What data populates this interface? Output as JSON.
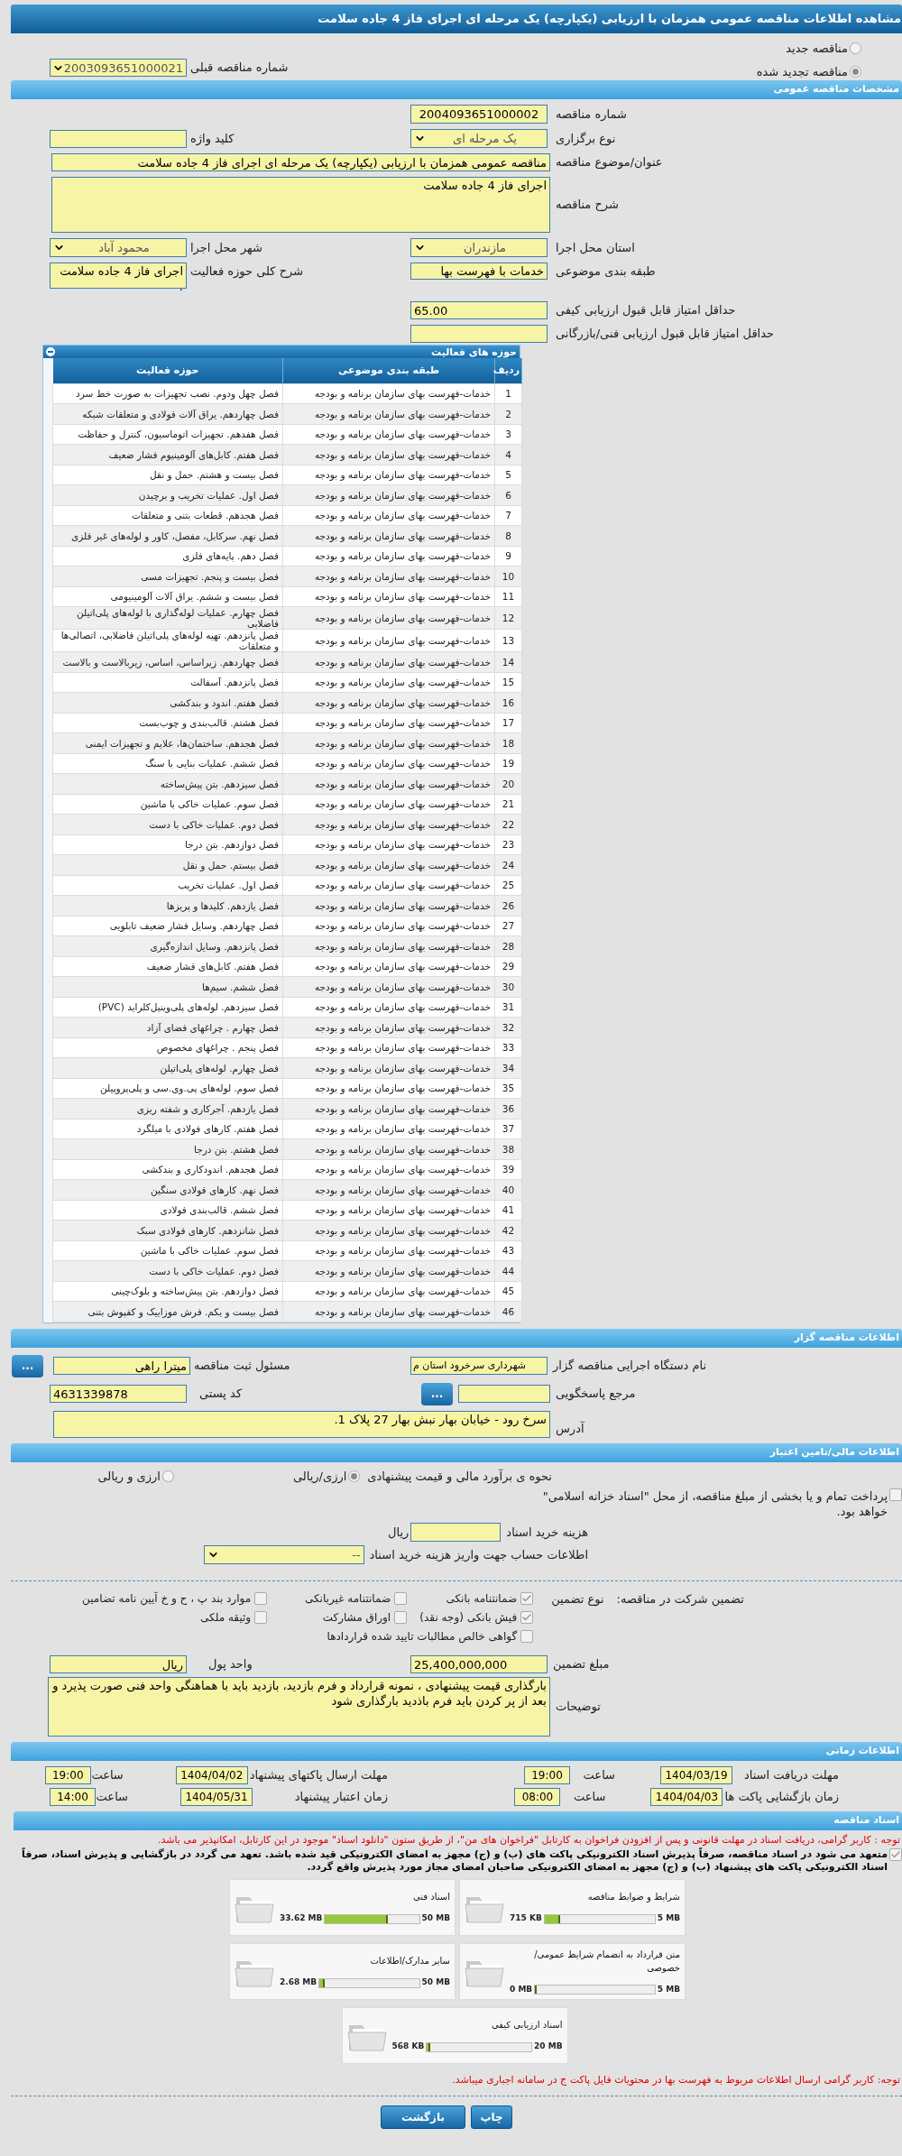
{
  "window": {
    "title": "مشاهده اطلاعات مناقصه عمومی همزمان با ارزیابی (یکپارچه) یک مرحله ای اجرای فاز 4 جاده سلامت"
  },
  "tender_status": [
    {
      "label": "مناقصه جدید",
      "selected": false
    },
    {
      "label": "مناقصه تجدید شده",
      "selected": true
    }
  ],
  "previous_tender": {
    "label": "شماره مناقصه قبلی",
    "value": "2003093651000021"
  },
  "general": {
    "title": "مشخصات مناقصه عمومی",
    "tender_number": {
      "label": "شماره مناقصه",
      "value": "2004093651000002"
    },
    "keyword": {
      "label": "کلید واژه"
    },
    "holding_type": {
      "label": "نوع برگزاری",
      "value": "یک مرحله ای"
    },
    "subject": {
      "label": "عنوان/موضوع مناقصه",
      "value": "مناقصه عمومی همزمان با ارزیابی (یکپارچه) یک مرحله ای اجرای فاز 4 جاده سلامت"
    },
    "description": {
      "label": "شرح مناقصه",
      "value": "اجرای فاز 4 جاده سلامت"
    },
    "city": {
      "label": "شهر محل اجرا",
      "value": "محمود آباد"
    },
    "province": {
      "label": "استان محل اجرا",
      "value": "مازندران"
    },
    "activity_scope": {
      "label": "شرح کلی حوزه فعالیت",
      "value": "اجرای فاز 4 جاده سلامت ."
    },
    "category": {
      "label": "طبقه بندی موضوعی",
      "value": "خدمات با فهرست بها"
    },
    "min_quality_score": {
      "label": "حداقل امتیاز قابل قبول ارزیابی کیفی",
      "value": "65.00"
    },
    "min_technical_score": {
      "label": "حداقل امتیاز قابل قبول ارزیابی فنی/بازرگانی"
    }
  },
  "activities": {
    "title": "حوزه های فعالیت",
    "columns": [
      "ردیف",
      "طبقه بندی موضوعی",
      "حوزه فعالیت"
    ],
    "rows": [
      [
        "1",
        "خدمات-فهرست بهای سازمان برنامه و بودجه",
        "فصل چهل ودوم. نصب تجهیزات به صورت خط سرد"
      ],
      [
        "2",
        "خدمات-فهرست بهای سازمان برنامه و بودجه",
        "فصل چهاردهم. یراق آلات فولادی و متعلقات شبکه"
      ],
      [
        "3",
        "خدمات-فهرست بهای سازمان برنامه و بودجه",
        "فصل هفدهم. تجهیزات اتوماسیون، کنترل و حفاظت"
      ],
      [
        "4",
        "خدمات-فهرست بهای سازمان برنامه و بودجه",
        "فصل هفتم. کابل‌های آلومینیوم فشار ضعیف"
      ],
      [
        "5",
        "خدمات-فهرست بهای سازمان برنامه و بودجه",
        "فصل بیست و هشتم. حمل و نقل"
      ],
      [
        "6",
        "خدمات-فهرست بهای سازمان برنامه و بودجه",
        "فصل اول. عملیات تخریب و برچیدن"
      ],
      [
        "7",
        "خدمات-فهرست بهای سازمان برنامه و بودجه",
        "فصل هجدهم. قطعات بتنی و متعلقات"
      ],
      [
        "8",
        "خدمات-فهرست بهای سازمان برنامه و بودجه",
        "فصل نهم. سرکابل، مفصل، کاور و لوله‌های غیر فلزی"
      ],
      [
        "9",
        "خدمات-فهرست بهای سازمان برنامه و بودجه",
        "فصل دهم. پایه‌های فلزی"
      ],
      [
        "10",
        "خدمات-فهرست بهای سازمان برنامه و بودجه",
        "فصل بیست و پنجم. تجهیزات مسی"
      ],
      [
        "11",
        "خدمات-فهرست بهای سازمان برنامه و بودجه",
        "فصل بیست و ششم. یراق آلات آلومینیومی"
      ],
      [
        "12",
        "خدمات-فهرست بهای سازمان برنامه و بودجه",
        "فصل چهارم. عملیات لوله‌گذاری با لوله‌های پلی‌اتیلن فاضلابی"
      ],
      [
        "13",
        "خدمات-فهرست بهای سازمان برنامه و بودجه",
        "فصل پانزدهم. تهیه لوله‌های پلی‌اتیلن فاضلابی، اتصالی‌ها و متعلقات"
      ],
      [
        "14",
        "خدمات-فهرست بهای سازمان برنامه و بودجه",
        "فصل چهاردهم. زیراساس، اساس، زیربالاست و بالاست"
      ],
      [
        "15",
        "خدمات-فهرست بهای سازمان برنامه و بودجه",
        "فصل پانزدهم. آسفالت"
      ],
      [
        "16",
        "خدمات-فهرست بهای سازمان برنامه و بودجه",
        "فصل هفتم. اندود و بندکشی"
      ],
      [
        "17",
        "خدمات-فهرست بهای سازمان برنامه و بودجه",
        "فصل هشتم. قالب‌بندی و چوب‌بست"
      ],
      [
        "18",
        "خدمات-فهرست بهای سازمان برنامه و بودجه",
        "فصل هجدهم. ساختمان‌ها، علایم و تجهیزات ایمنی"
      ],
      [
        "19",
        "خدمات-فهرست بهای سازمان برنامه و بودجه",
        "فصل ششم. عملیات بنایی با سنگ"
      ],
      [
        "20",
        "خدمات-فهرست بهای سازمان برنامه و بودجه",
        "فصل سیزدهم. بتن پیش‌ساخته"
      ],
      [
        "21",
        "خدمات-فهرست بهای سازمان برنامه و بودجه",
        "فصل سوم. عملیات خاکی با ماشین"
      ],
      [
        "22",
        "خدمات-فهرست بهای سازمان برنامه و بودجه",
        "فصل دوم. عملیات خاکی با دست"
      ],
      [
        "23",
        "خدمات-فهرست بهای سازمان برنامه و بودجه",
        "فصل دوازدهم. بتن درجا"
      ],
      [
        "24",
        "خدمات-فهرست بهای سازمان برنامه و بودجه",
        "فصل بیستم. حمل و نقل"
      ],
      [
        "25",
        "خدمات-فهرست بهای سازمان برنامه و بودجه",
        "فصل اول. عملیات تخریب"
      ],
      [
        "26",
        "خدمات-فهرست بهای سازمان برنامه و بودجه",
        "فصل یازدهم. کلیدها و پریزها"
      ],
      [
        "27",
        "خدمات-فهرست بهای سازمان برنامه و بودجه",
        "فصل چهاردهم. وسایل فشار ضعیف تابلویی"
      ],
      [
        "28",
        "خدمات-فهرست بهای سازمان برنامه و بودجه",
        "فصل پانزدهم. وسایل اندازه‌گیری"
      ],
      [
        "29",
        "خدمات-فهرست بهای سازمان برنامه و بودجه",
        "فصل هفتم. کابل‌های فشار ضعیف"
      ],
      [
        "30",
        "خدمات-فهرست بهای سازمان برنامه و بودجه",
        "فصل ششم. سیم‌ها"
      ],
      [
        "31",
        "خدمات-فهرست بهای سازمان برنامه و بودجه",
        "فصل سیزدهم. لوله‌های پلی‌وینیل‌کلراید (PVC)"
      ],
      [
        "32",
        "خدمات-فهرست بهای سازمان برنامه و بودجه",
        "فصل چهارم . چراغهای فضای آزاد"
      ],
      [
        "33",
        "خدمات-فهرست بهای سازمان برنامه و بودجه",
        "فصل پنجم . چراغهای مخصوص"
      ],
      [
        "34",
        "خدمات-فهرست بهای سازمان برنامه و بودجه",
        "فصل چهارم. لوله‌های پلی‌اتیلن"
      ],
      [
        "35",
        "خدمات-فهرست بهای سازمان برنامه و بودجه",
        "فصل سوم. لوله‌های پی.وی.سی و پلی‌پروپیلن"
      ],
      [
        "36",
        "خدمات-فهرست بهای سازمان برنامه و بودجه",
        "فصل یازدهم. آجرکاری و شفته ریزی"
      ],
      [
        "37",
        "خدمات-فهرست بهای سازمان برنامه و بودجه",
        "فصل هفتم. کارهای فولادی با میلگرد"
      ],
      [
        "38",
        "خدمات-فهرست بهای سازمان برنامه و بودجه",
        "فصل هشتم. بتن درجا"
      ],
      [
        "39",
        "خدمات-فهرست بهای سازمان برنامه و بودجه",
        "فصل هجدهم. اندودکاری و بندکشی"
      ],
      [
        "40",
        "خدمات-فهرست بهای سازمان برنامه و بودجه",
        "فصل نهم. کارهای فولادی سنگین"
      ],
      [
        "41",
        "خدمات-فهرست بهای سازمان برنامه و بودجه",
        "فصل ششم. قالب‌بندی فولادی"
      ],
      [
        "42",
        "خدمات-فهرست بهای سازمان برنامه و بودجه",
        "فصل شانزدهم. کارهای فولادی سبک"
      ],
      [
        "43",
        "خدمات-فهرست بهای سازمان برنامه و بودجه",
        "فصل سوم. عملیات خاکی با ماشین"
      ],
      [
        "44",
        "خدمات-فهرست بهای سازمان برنامه و بودجه",
        "فصل دوم. عملیات خاکی با دست"
      ],
      [
        "45",
        "خدمات-فهرست بهای سازمان برنامه و بودجه",
        "فصل دوازدهم. بتن پیش‌ساخته و بلوک‌چینی"
      ],
      [
        "46",
        "خدمات-فهرست بهای سازمان برنامه و بودجه",
        "فصل بیست و یکم. فرش موزاییک و کفپوش بتنی"
      ]
    ]
  },
  "organizer": {
    "title": "اطلاعات مناقصه گزار",
    "agency": {
      "label": "نام دستگاه اجرایی مناقصه گزار",
      "value": "شهرداری سرخرود استان م"
    },
    "registrar": {
      "label": "مسئول ثبت مناقصه",
      "value": "میترا راهی"
    },
    "registrar_button": "...",
    "reference": {
      "label": "مرجع پاسخگویی"
    },
    "reference_button": "...",
    "postal_code": {
      "label": "کد پستی",
      "value": "4631339878"
    },
    "address": {
      "label": "آدرس",
      "value": "سرخ رود - خیابان بهار نبش بهار 27 پلاک 1."
    }
  },
  "finance": {
    "title": "اطلاعات مالی/تامین اعتبار",
    "estimate_label": "نحوه ی برآورد مالی و قیمت پیشنهادی",
    "estimate_options": [
      {
        "label": "ارزی/ریالی",
        "selected": true
      },
      {
        "label": "ارزی و ریالی",
        "selected": false
      }
    ],
    "treasury": {
      "label": "پرداخت تمام و یا بخشی از مبلغ مناقصه، از محل \"اسناد خزانه اسلامی\" خواهد بود.",
      "checked": false
    },
    "doc_fee": {
      "label": "هزینه خرید اسناد",
      "unit": "ریال"
    },
    "account": {
      "label": "اطلاعات حساب جهت واریز هزینه خرید اسناد",
      "value": "--"
    }
  },
  "guarantee": {
    "label": "تضمین شرکت در مناقصه:",
    "type_label": "نوع تضمین",
    "options": [
      {
        "label": "ضمانتنامه بانکی",
        "checked": true
      },
      {
        "label": "ضمانتنامه غیربانکی",
        "checked": false
      },
      {
        "label": "موارد بند پ ، ح و خ آیین نامه تضامین",
        "checked": false
      },
      {
        "label": "فیش بانکی (وجه نقد)",
        "checked": true
      },
      {
        "label": "اوراق مشارکت",
        "checked": false
      },
      {
        "label": "وثیقه ملکی",
        "checked": false
      },
      {
        "label": "گواهی خالص مطالبات تایید شده قراردادها",
        "checked": false
      }
    ],
    "amount": {
      "label": "مبلغ تضمین",
      "value": "25,400,000,000"
    },
    "currency": {
      "label": "واحد پول",
      "value": "ریال"
    },
    "notes": {
      "label": "توضیحات",
      "value": "بارگذاری قیمت پیشنهادی ، نمونه قرارداد و فرم بازدید، بازدید باید با هماهنگی واحد فنی صورت پذیرد و بعد از پر کردن باید فرم باذدید بارگذاری شود"
    }
  },
  "schedule": {
    "title": "اطلاعات زمانی",
    "rows": [
      [
        {
          "label": "مهلت دریافت اسناد",
          "date": "1404/03/19",
          "time_label": "ساعت",
          "time": "19:00"
        },
        {
          "label": "مهلت ارسال پاکتهای پیشنهاد",
          "date": "1404/04/02",
          "time_label": "ساعت",
          "time": "19:00"
        }
      ],
      [
        {
          "label": "زمان بازگشایی پاکت ها",
          "date": "1404/04/03",
          "time_label": "ساعت",
          "time": "08:00"
        },
        {
          "label": "زمان اعتبار پیشنهاد",
          "date": "1404/05/31",
          "time_label": "ساعت",
          "time": "14:00"
        }
      ]
    ]
  },
  "documents": {
    "title": "اسناد مناقصه",
    "notice": "توجه : کاربر گرامی، دریافت اسناد در مهلت قانونی و پس از افزودن فراخوان به کارتابل \"فراخوان های من\"، از طریق ستون \"دانلود اسناد\" موجود در این کارتابل، امکانپذیر می باشد.",
    "commitment": {
      "text": "متعهد می شود در اسناد مناقصه، صرفاً پذیرش اسناد الکترونیکی پاکت های (ب) و (ج) مجهز به امضای الکترونیکی قید شده باشد. تعهد می گردد در بازگشایی و پذیرش اسناد، صرفاً اسناد الکترونیکی پاکت های پیشنهاد (ب) و (ج) مجهز به امضای الکترونیکی صاحبان امضای مجاز مورد پذیرش واقع گردد.",
      "checked": true
    },
    "files": [
      {
        "name": "شرایط و ضوابط مناقصه",
        "used": "715 KB",
        "max": "5 MB",
        "level": 0.14
      },
      {
        "name": "اسناد فنی",
        "used": "33.62 MB",
        "max": "50 MB",
        "level": 0.67
      },
      {
        "name": "متن قرارداد به انضمام شرایط عمومی/خصوصی",
        "used": "0 MB",
        "max": "5 MB",
        "level": 0
      },
      {
        "name": "سایر مدارک/اطلاعات",
        "used": "2.68 MB",
        "max": "50 MB",
        "level": 0.05
      },
      {
        "name": "اسناد ارزیابی کیفی",
        "used": "568 KB",
        "max": "20 MB",
        "level": 0.03
      }
    ],
    "footer_note": "توجه: کاربر گرامی ارسال اطلاعات مربوط به فهرست بها در محتویات فایل پاکت ج در سامانه اجباری میباشد."
  },
  "buttons": [
    {
      "label": "چاپ"
    },
    {
      "label": "بازگشت"
    }
  ]
}
